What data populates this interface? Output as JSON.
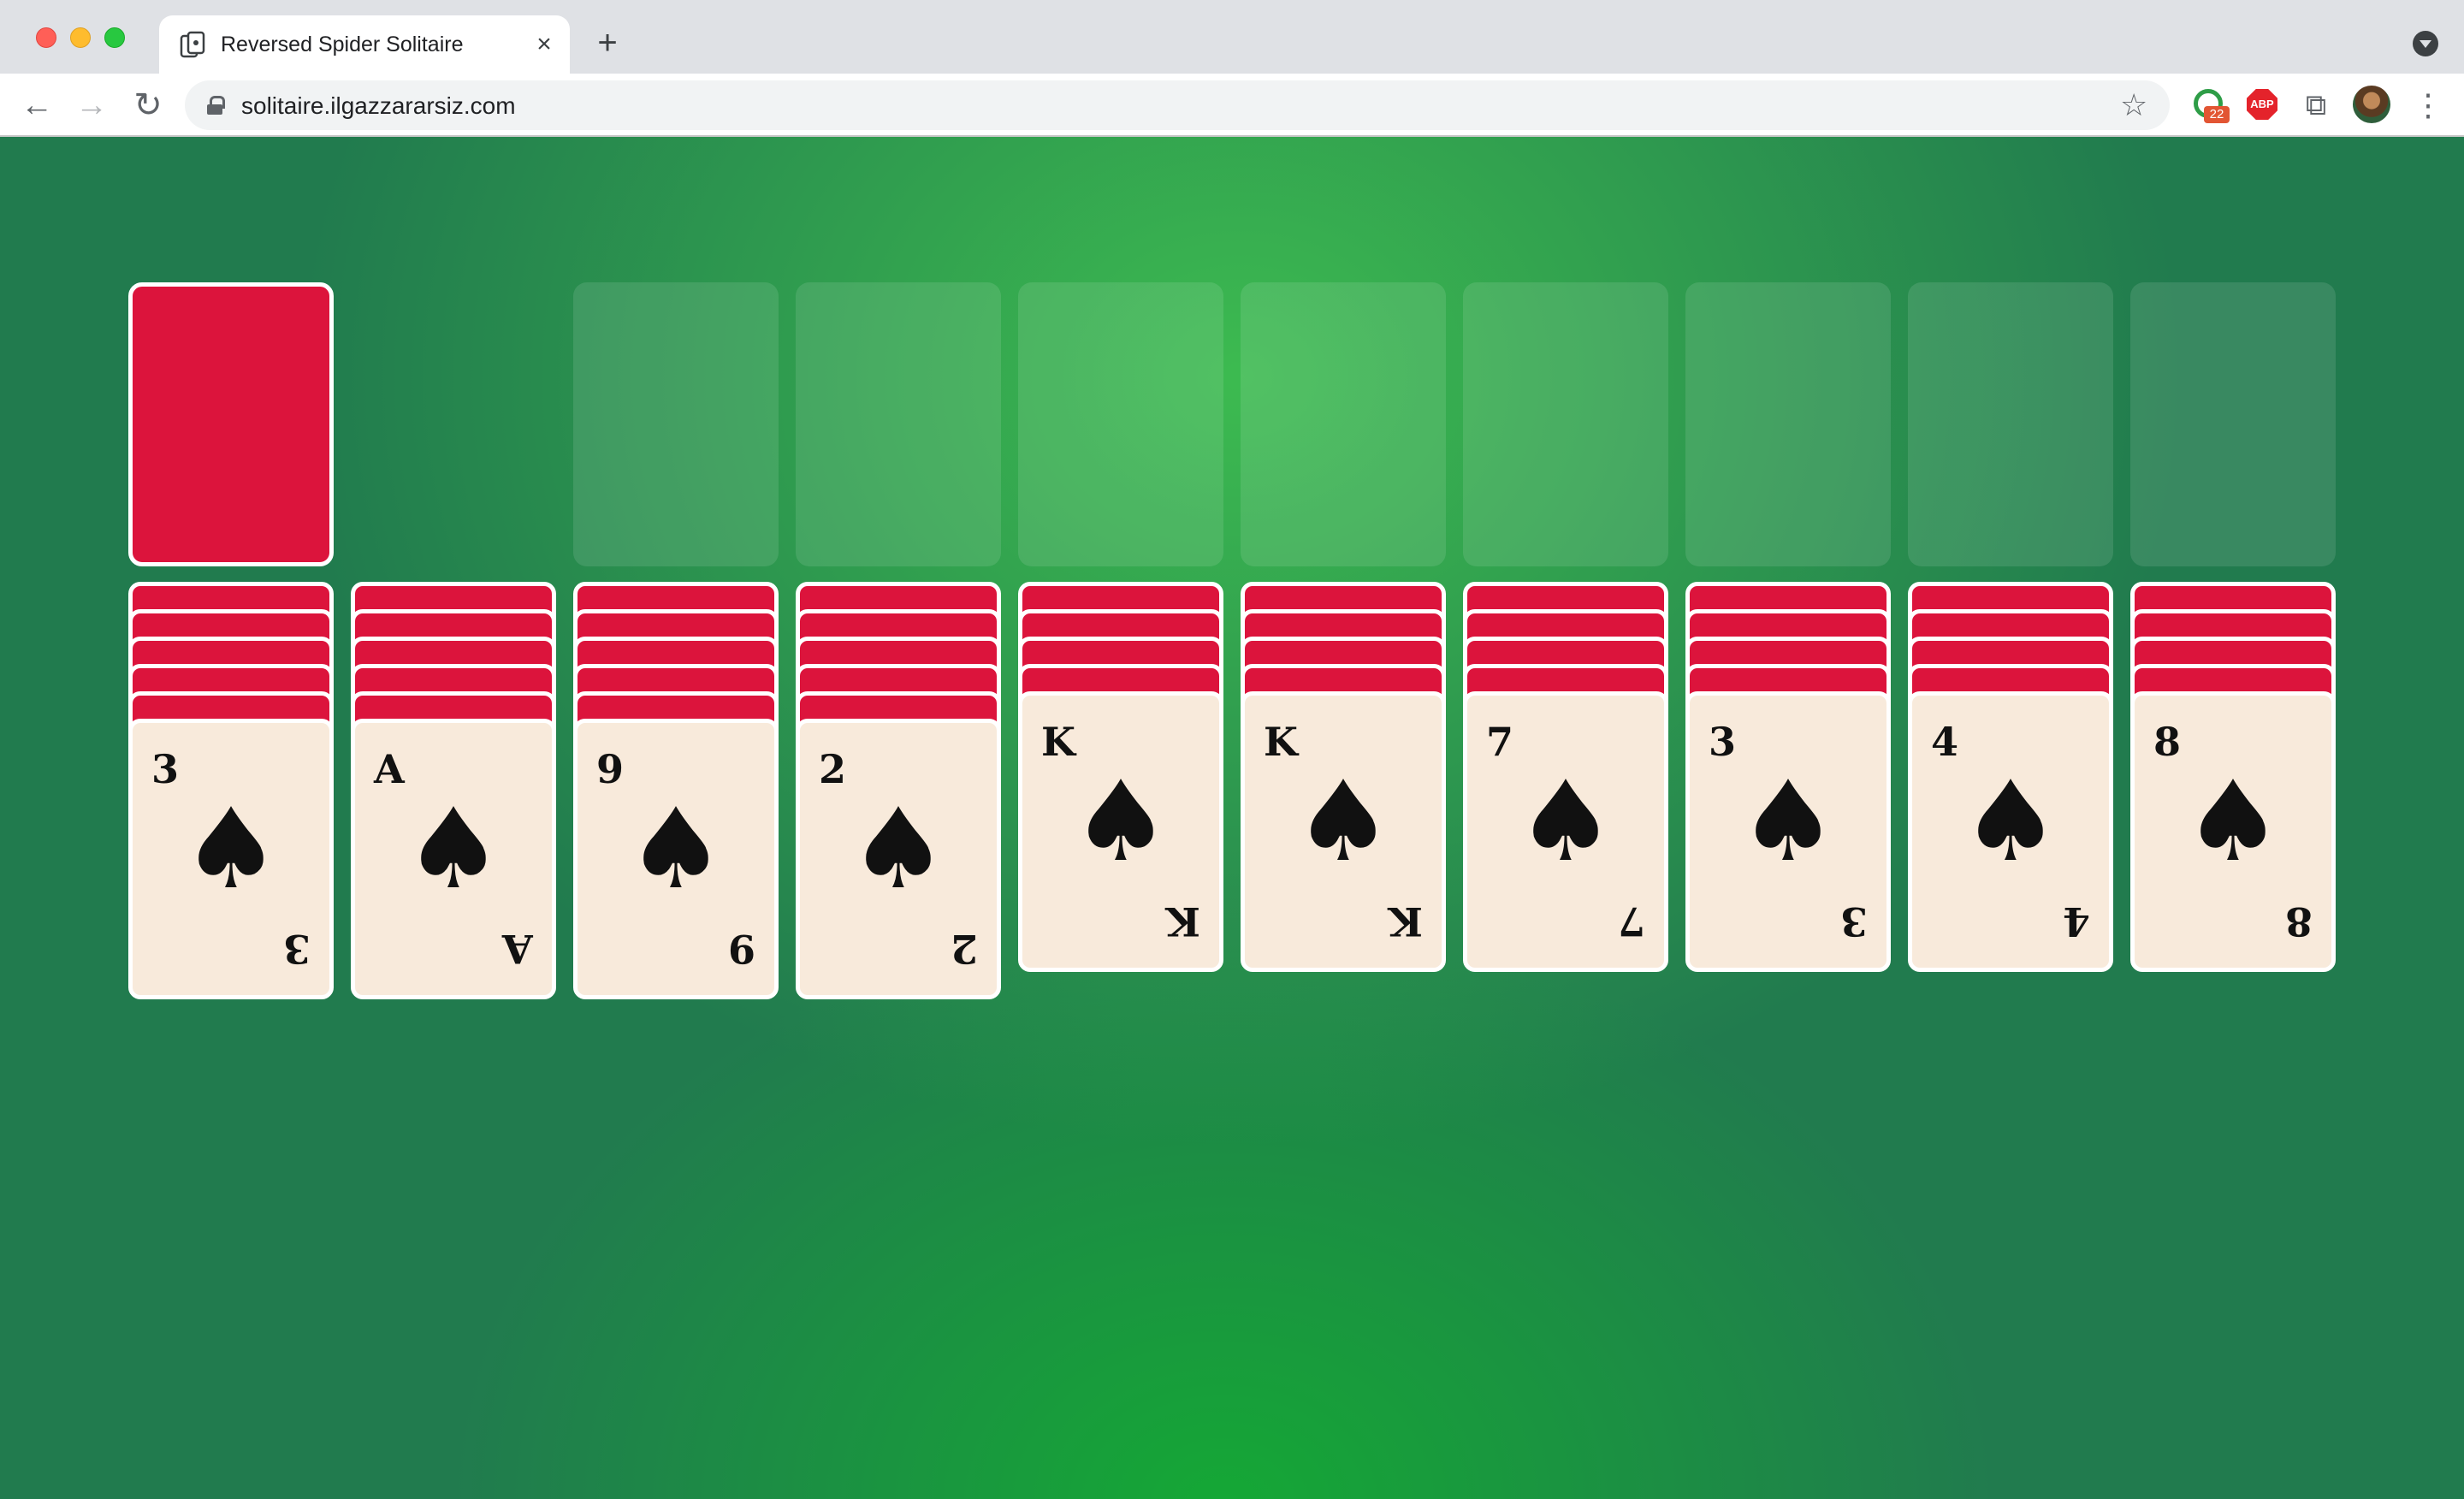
{
  "browser": {
    "tab_title": "Reversed Spider Solitaire",
    "tab_close_glyph": "×",
    "new_tab_glyph": "+",
    "url": "solitaire.ilgazzararsiz.com",
    "back_glyph": "←",
    "forward_glyph": "→",
    "reload_glyph": "↻",
    "star_glyph": "☆",
    "extension_badge": "22",
    "abp_label": "ABP",
    "puzzle_glyph": "⧉",
    "kebab_glyph": "⋮",
    "icons": [
      "favicon-cards-icon",
      "lock-icon",
      "star-icon",
      "extension-icon",
      "adblock-icon",
      "puzzle-icon",
      "avatar",
      "menu-icon"
    ]
  },
  "game": {
    "colors": {
      "felt": "#217b4e",
      "card_back": "#dc143c",
      "card_face": "#f8eadb"
    },
    "stock": {
      "face": "down"
    },
    "foundations": 8,
    "tableau": [
      {
        "face_down": 5,
        "rank": "3",
        "suit": "♠"
      },
      {
        "face_down": 5,
        "rank": "A",
        "suit": "♠"
      },
      {
        "face_down": 5,
        "rank": "9",
        "suit": "♠"
      },
      {
        "face_down": 5,
        "rank": "2",
        "suit": "♠"
      },
      {
        "face_down": 4,
        "rank": "K",
        "suit": "♠"
      },
      {
        "face_down": 4,
        "rank": "K",
        "suit": "♠"
      },
      {
        "face_down": 4,
        "rank": "7",
        "suit": "♠"
      },
      {
        "face_down": 4,
        "rank": "3",
        "suit": "♠"
      },
      {
        "face_down": 4,
        "rank": "4",
        "suit": "♠"
      },
      {
        "face_down": 4,
        "rank": "8",
        "suit": "♠"
      }
    ]
  }
}
